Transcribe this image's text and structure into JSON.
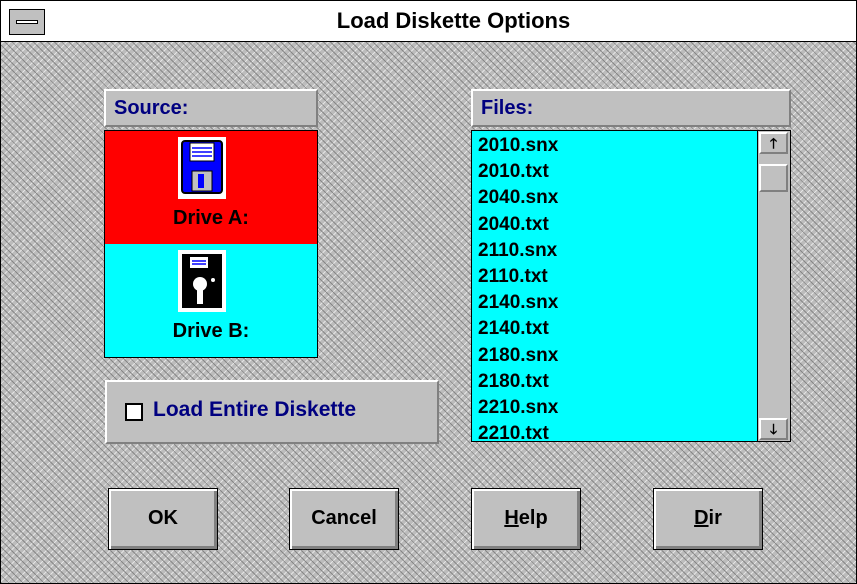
{
  "window": {
    "title": "Load Diskette Options"
  },
  "source": {
    "label": "Source:",
    "drives": [
      {
        "label": "Drive A:",
        "icon": "floppy-3.5-icon",
        "selected": true,
        "color": "#ff0000"
      },
      {
        "label": "Drive B:",
        "icon": "floppy-5.25-icon",
        "selected": false,
        "color": "#00ffff"
      }
    ]
  },
  "options": {
    "load_entire_label": "Load Entire Diskette",
    "load_entire_checked": false
  },
  "files": {
    "label": "Files:",
    "items": [
      "2010.snx",
      "2010.txt",
      "2040.snx",
      "2040.txt",
      "2110.snx",
      "2110.txt",
      "2140.snx",
      "2140.txt",
      "2180.snx",
      "2180.txt",
      "2210.snx",
      "2210.txt"
    ]
  },
  "buttons": {
    "ok": "OK",
    "cancel": "Cancel",
    "help_mnemonic": "H",
    "help_rest": "elp",
    "dir_mnemonic": "D",
    "dir_rest": "ir"
  },
  "scrollbar": {
    "up_arrow": "🡑",
    "down_arrow": "🡓"
  },
  "colors": {
    "list_bg": "#00ffff",
    "selected_drive": "#ff0000",
    "label_text": "#000080"
  }
}
